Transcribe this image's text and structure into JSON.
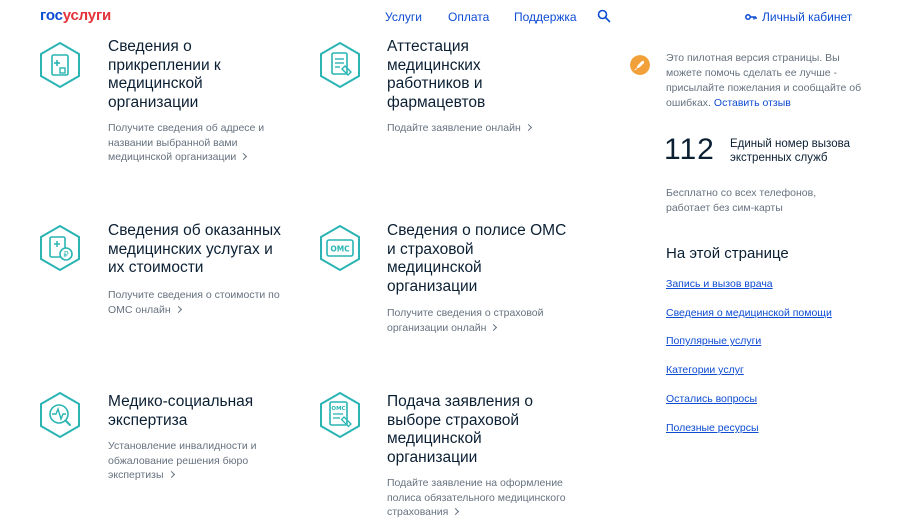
{
  "header": {
    "logo_gos": "гос",
    "logo_uslugi": "услуги",
    "nav": [
      "Услуги",
      "Оплата",
      "Поддержка"
    ],
    "cabinet_label": "Личный кабинет"
  },
  "cards": [
    {
      "title": "Сведения о прикреплении к медицинской организации",
      "desc": "Получите сведения об адресе и названии выбранной вами медицинской организации",
      "icon": "hospital-document-icon"
    },
    {
      "title": "Аттестация медицинских работников и фармацевтов",
      "desc": "Подайте заявление онлайн",
      "icon": "certificate-icon"
    },
    {
      "title": "Сведения об оказанных медицинских услугах и их стоимости",
      "desc": "Получите сведения о стоимости по ОМС онлайн",
      "icon": "medical-cost-icon"
    },
    {
      "title": "Сведения о полисе ОМС и страховой медицинской организации",
      "desc": "Получите сведения о страховой организации онлайн",
      "icon": "oms-card-icon"
    },
    {
      "title": "Медико-социальная экспертиза",
      "desc": "Установление инвалидности и обжалование решения бюро экспертизы",
      "icon": "expertise-icon"
    },
    {
      "title": "Подача заявления о выборе страховой медицинской организации",
      "desc": "Подайте заявление на оформление полиса обязательного медицинского страхования",
      "icon": "oms-application-icon"
    }
  ],
  "sidebar": {
    "pilot_text": "Это пилотная версия страницы. Вы можете помочь сделать ее лучше - присылайте пожелания и сообщайте об ошибках.",
    "pilot_link": "Оставить отзыв",
    "emergency_number": "112",
    "emergency_label": "Единый номер вызова экстренных служб",
    "emergency_note": "Бесплатно со всех телефонов, работает без сим-карты",
    "on_page_title": "На этой странице",
    "toc": [
      "Запись и вызов врача",
      "Сведения о медицинской помощи",
      "Популярные услуги",
      "Категории услуг",
      "Остались вопросы",
      "Полезные ресурсы"
    ]
  },
  "colors": {
    "link": "#0d4cd3",
    "icon_teal": "#2ab5b4",
    "pilot_orange": "#f2a03a",
    "logo_red": "#e3323a",
    "muted_text": "#66727f"
  }
}
